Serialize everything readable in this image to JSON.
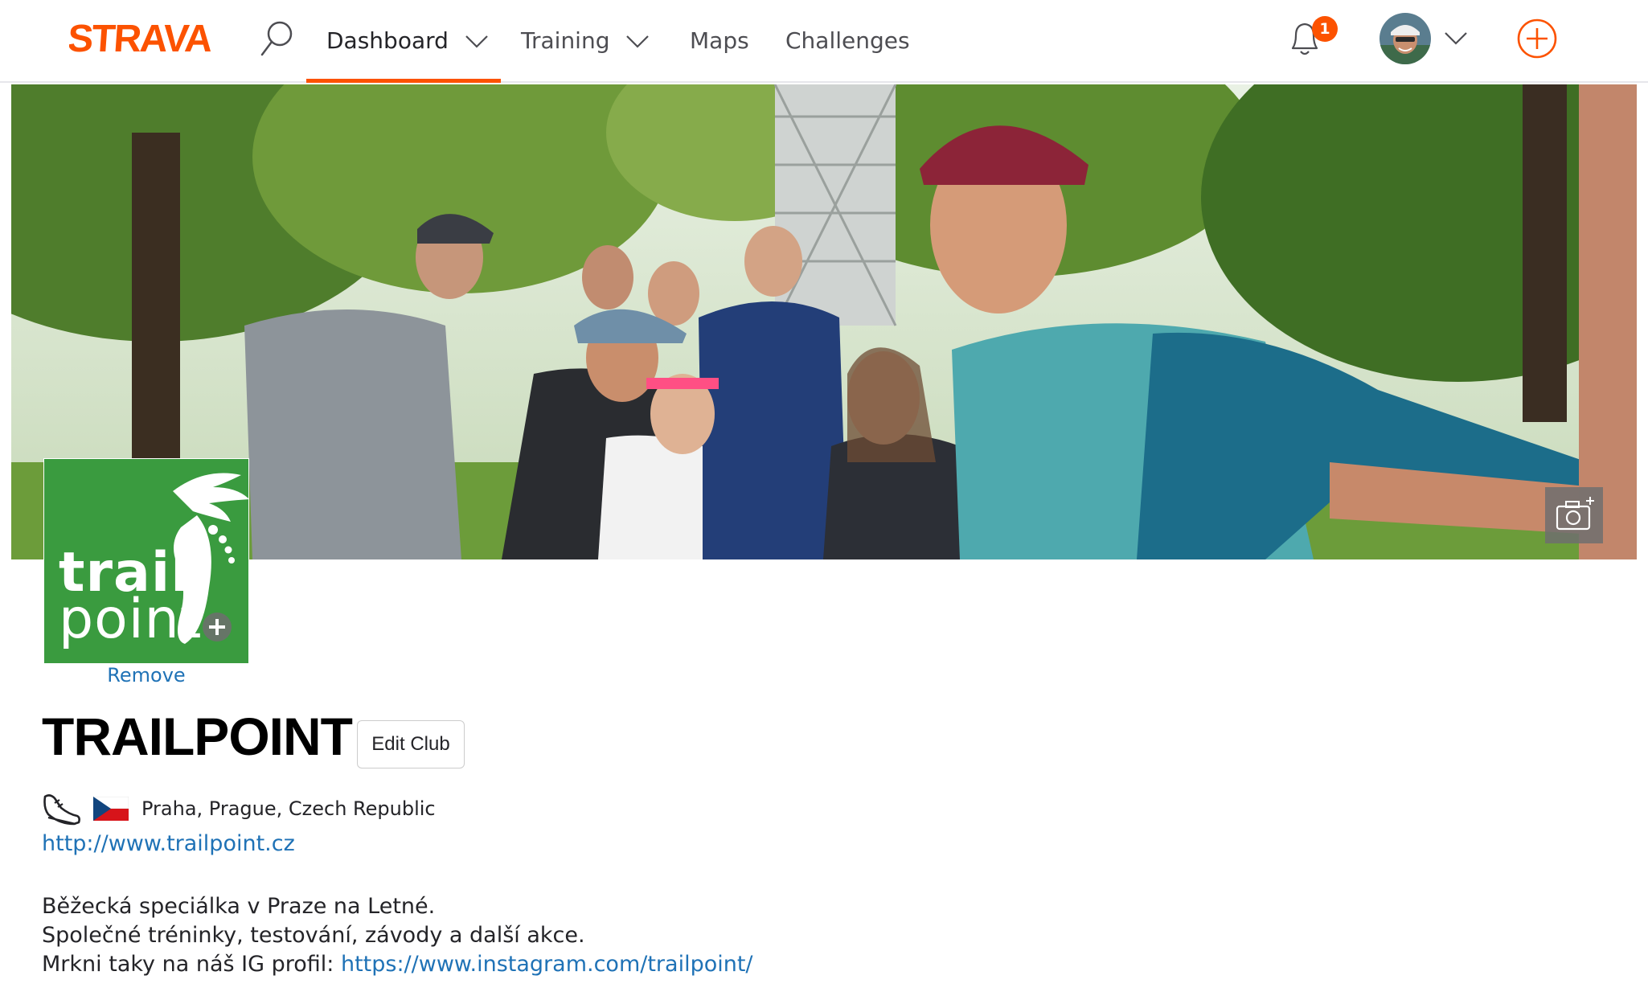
{
  "brand": {
    "logo_text": "STRAVA",
    "accent": "#fc5200"
  },
  "nav": {
    "items": [
      {
        "label": "Dashboard",
        "has_dropdown": true,
        "active": true
      },
      {
        "label": "Training",
        "has_dropdown": true,
        "active": false
      },
      {
        "label": "Maps",
        "has_dropdown": false,
        "active": false
      },
      {
        "label": "Challenges",
        "has_dropdown": false,
        "active": false
      }
    ],
    "notification_count": "1",
    "icons": [
      "search-icon",
      "bell-icon",
      "avatar",
      "chevron-down-icon",
      "add-circle-icon"
    ]
  },
  "cover": {
    "edit_icon": "camera-icon"
  },
  "club": {
    "logo": {
      "line1": "trail",
      "line2": "point",
      "bg": "#3a9b3f",
      "icon": "winged-foot"
    },
    "remove_label": "Remove",
    "name": "TRAILPOINT",
    "edit_label": "Edit Club",
    "sport_icon": "running-shoe-icon",
    "country_flag": "czech-flag-icon",
    "location": "Praha, Prague, Czech Republic",
    "website": "http://www.trailpoint.cz",
    "description": {
      "line1": "Běžecká speciálka v Praze na Letné.",
      "line2": "Společné tréninky, testování, závody a další akce.",
      "line3_prefix": "Mrkni taky na náš IG profil: ",
      "line3_link": "https://www.instagram.com/trailpoint/"
    }
  },
  "colors": {
    "link": "#1f72b6",
    "text": "#242428"
  }
}
